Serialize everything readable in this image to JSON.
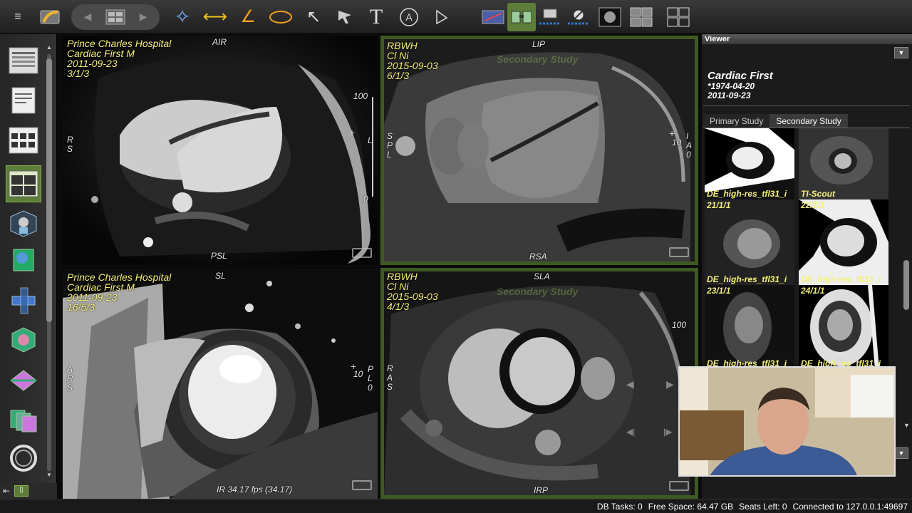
{
  "toolbar": {
    "tools": [
      {
        "name": "menu-icon",
        "glyph": "☰"
      },
      {
        "name": "import-icon",
        "glyph": "↗"
      },
      {
        "name": "star-tool-icon",
        "glyph": "✧"
      },
      {
        "name": "length-tool-icon",
        "glyph": "⟷"
      },
      {
        "name": "angle-tool-icon",
        "glyph": "∠"
      },
      {
        "name": "ellipse-roi-icon",
        "glyph": "◯"
      },
      {
        "name": "arrow-tool-icon",
        "glyph": "↖"
      },
      {
        "name": "pointer-tool-icon",
        "glyph": "➤"
      },
      {
        "name": "text-tool-icon",
        "glyph": "T"
      },
      {
        "name": "text-annotation-icon",
        "glyph": "Ⓐ"
      },
      {
        "name": "select-tool-icon",
        "glyph": "▷"
      }
    ]
  },
  "viewports": [
    {
      "id": "top-left",
      "hospital": "Prince Charles Hospital",
      "patient": "Cardiac First  M",
      "date": "2011-09-23",
      "series": "3/1/3",
      "orient_top": "AIR",
      "orient_left": "R\nS",
      "orient_right": "L",
      "orient_bottom": "PSL",
      "scale_top": "100",
      "scale_bottom": "0",
      "watermark": ""
    },
    {
      "id": "top-right",
      "hospital": "RBWH",
      "patient": "Cl Ni",
      "date": "2015-09-03",
      "series": "6/1/3",
      "orient_top": "LIP",
      "orient_left": "S\nP\nL",
      "orient_right": "I\nA\n0",
      "orient_bottom": "RSA",
      "scale_top": "10",
      "scale_bottom": "",
      "watermark": "Secondary Study"
    },
    {
      "id": "bottom-left",
      "hospital": "Prince Charles Hospital",
      "patient": "Cardiac First  M",
      "date": "2011-09-23",
      "series": "16/5/3",
      "orient_top": "SL",
      "orient_left": "A\nR\nS",
      "orient_right": "P\nL\n0",
      "orient_bottom": "IR  34.17 fps (34.17)",
      "scale_top": "10",
      "scale_bottom": "",
      "watermark": ""
    },
    {
      "id": "bottom-right",
      "hospital": "RBWH",
      "patient": "Cl Ni",
      "date": "2015-09-03",
      "series": "4/1/3",
      "orient_top": "SLA",
      "orient_left": "R\nA\nS",
      "orient_right": "",
      "orient_bottom": "IRP",
      "scale_top": "100",
      "scale_bottom": "",
      "watermark": "Secondary Study"
    }
  ],
  "right_panel": {
    "header": "Viewer",
    "patient_name": "Cardiac First",
    "birth_date": "*1974-04-20",
    "study_date": "2011-09-23",
    "tabs": [
      "Primary Study",
      "Secondary Study"
    ],
    "active_tab": 1,
    "thumbnails": [
      {
        "num": "",
        "caption": "DE_high-res_tfl31_i"
      },
      {
        "num": "",
        "caption": "TI-Scout"
      },
      {
        "num": "21/1/1",
        "caption": "DE_high-res_tfl31_i"
      },
      {
        "num": "22/1/1",
        "caption": "DE_high-res_tfl31_i"
      },
      {
        "num": "23/1/1",
        "caption": "DE_high-res_tfl31_i"
      },
      {
        "num": "24/1/1",
        "caption": "DE_high-res_tfl31_i"
      }
    ]
  },
  "status": {
    "db_tasks": "DB Tasks: 0",
    "free_space": "Free Space: 64.47 GB",
    "seats": "Seats Left: 0",
    "connection": "Connected to 127.0.0.1:49697"
  }
}
